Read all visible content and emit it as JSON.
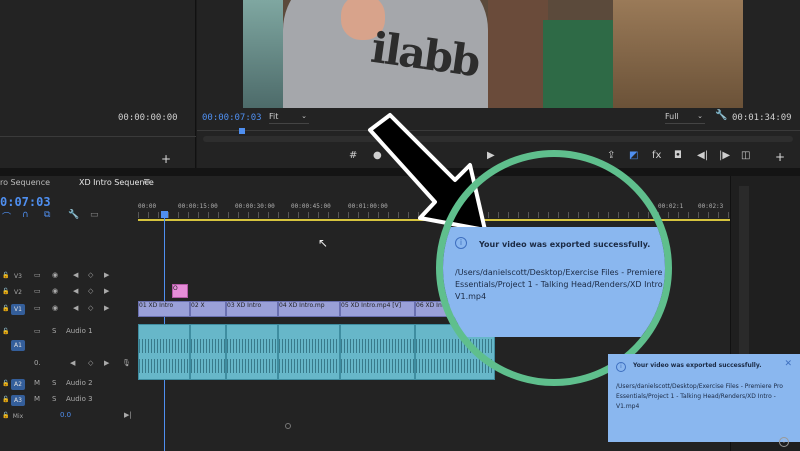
{
  "source_monitor": {
    "timecode": "00:00:00:00",
    "add_icon": "+"
  },
  "program_monitor": {
    "timecode": "00:00:07:03",
    "fit_label": "Fit",
    "quality_label": "Full",
    "duration": "00:01:34:09",
    "shirt_text": "ilabb",
    "add_icon": "+"
  },
  "timeline": {
    "tabs": [
      {
        "label": "ro Sequence"
      },
      {
        "label": "XD Intro Sequence"
      }
    ],
    "menu_icon": "≡",
    "timecode": "0:07:03",
    "ruler_labels": [
      "00:00",
      "00:00:15:00",
      "00:00:30:00",
      "00:00:45:00",
      "00:01:00:00",
      "00:02:1",
      "00:02:3"
    ],
    "tracks": [
      {
        "name": "V3"
      },
      {
        "name": "V2"
      },
      {
        "name": "V1"
      },
      {
        "name": "A1",
        "label": "Audio 1"
      },
      {
        "name": "A2",
        "label": "Audio 2"
      },
      {
        "name": "A3",
        "label": "Audio 3"
      },
      {
        "name": "Mix",
        "value": "0.0"
      }
    ],
    "video_clips": [
      {
        "label": "01 XD Intro"
      },
      {
        "label": "02 X"
      },
      {
        "label": "03 XD Intro"
      },
      {
        "label": "04 XD Intro.mp"
      },
      {
        "label": "05 XD Intro.mp4 [V]"
      },
      {
        "label": "06 XD Intro"
      }
    ],
    "small_clip_label": "O"
  },
  "callout": {
    "title": "Your video was exported successfully.",
    "path": "/Users/danielscott/Desktop/Exercise Files - Premiere Essentials/Project 1 - Talking Head/Renders/XD Intro V1.mp4",
    "info_icon": "i"
  },
  "toast": {
    "title": "Your video was exported successfully.",
    "path": "/Users/danielscott/Desktop/Exercise Files - Premiere Pro Essentials/Project 1 - Talking Head/Renders/XD Intro - V1.mp4",
    "close_icon": "✕",
    "info_icon": "i"
  },
  "colors": {
    "accent_blue": "#4f8ff0",
    "toast_bg": "#8ab7ef",
    "circle_border": "#5fbf8d"
  }
}
